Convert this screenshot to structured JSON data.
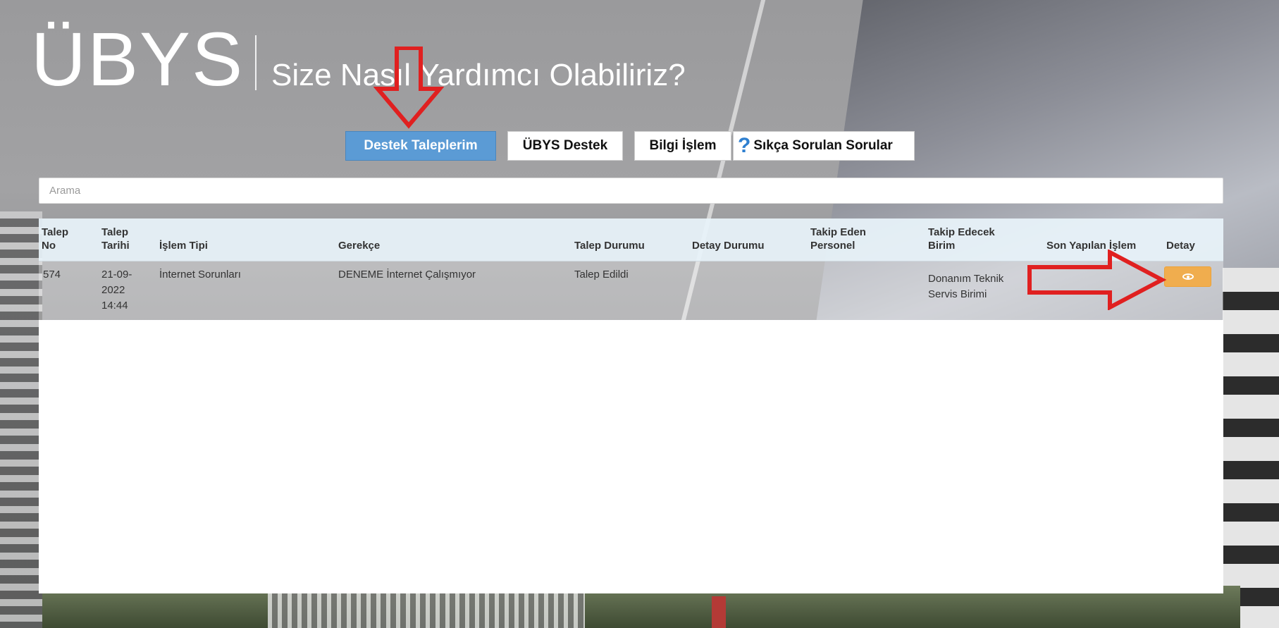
{
  "header": {
    "logo": "ÜBYS",
    "tagline": "Size Nasıl Yardımcı Olabiliriz?"
  },
  "nav": {
    "destek_taleplerim": "Destek Taleplerim",
    "ubys_destek": "ÜBYS Destek",
    "bilgi_islem": "Bilgi İşlem",
    "sss": "Sıkça Sorulan Sorular",
    "sss_icon": "question-mark-icon"
  },
  "search": {
    "placeholder": "Arama"
  },
  "table": {
    "columns": [
      {
        "line1": "Talep",
        "line2": "No"
      },
      {
        "line1": "Talep",
        "line2": "Tarihi"
      },
      {
        "line1": "",
        "line2": "İşlem Tipi"
      },
      {
        "line1": "",
        "line2": "Gerekçe"
      },
      {
        "line1": "",
        "line2": "Talep Durumu"
      },
      {
        "line1": "",
        "line2": "Detay Durumu"
      },
      {
        "line1": "Takip Eden",
        "line2": "Personel"
      },
      {
        "line1": "Takip Edecek",
        "line2": "Birim"
      },
      {
        "line1": "",
        "line2": "Son Yapılan İşlem"
      },
      {
        "line1": "",
        "line2": "Detay"
      }
    ],
    "rows": [
      {
        "talep_no": "574",
        "talep_tarihi_l1": "21-09-",
        "talep_tarihi_l2": "2022",
        "talep_tarihi_l3": "14:44",
        "islem_tipi": "İnternet Sorunları",
        "gerekce": "DENEME İnternet Çalışmıyor",
        "talep_durumu": "Talep Edildi",
        "detay_durumu": "",
        "takip_eden_personel": "",
        "takip_edecek_birim_l1": "Donanım Teknik",
        "takip_edecek_birim_l2": "Servis Birimi",
        "son_yapilan_islem": "",
        "detay_icon": "eye-icon"
      }
    ]
  },
  "colors": {
    "primary_button": "#5b9bd5",
    "detail_button": "#f0ad4e",
    "annotation_arrow": "#e02020",
    "table_header_bg": "#e8f3fa"
  }
}
